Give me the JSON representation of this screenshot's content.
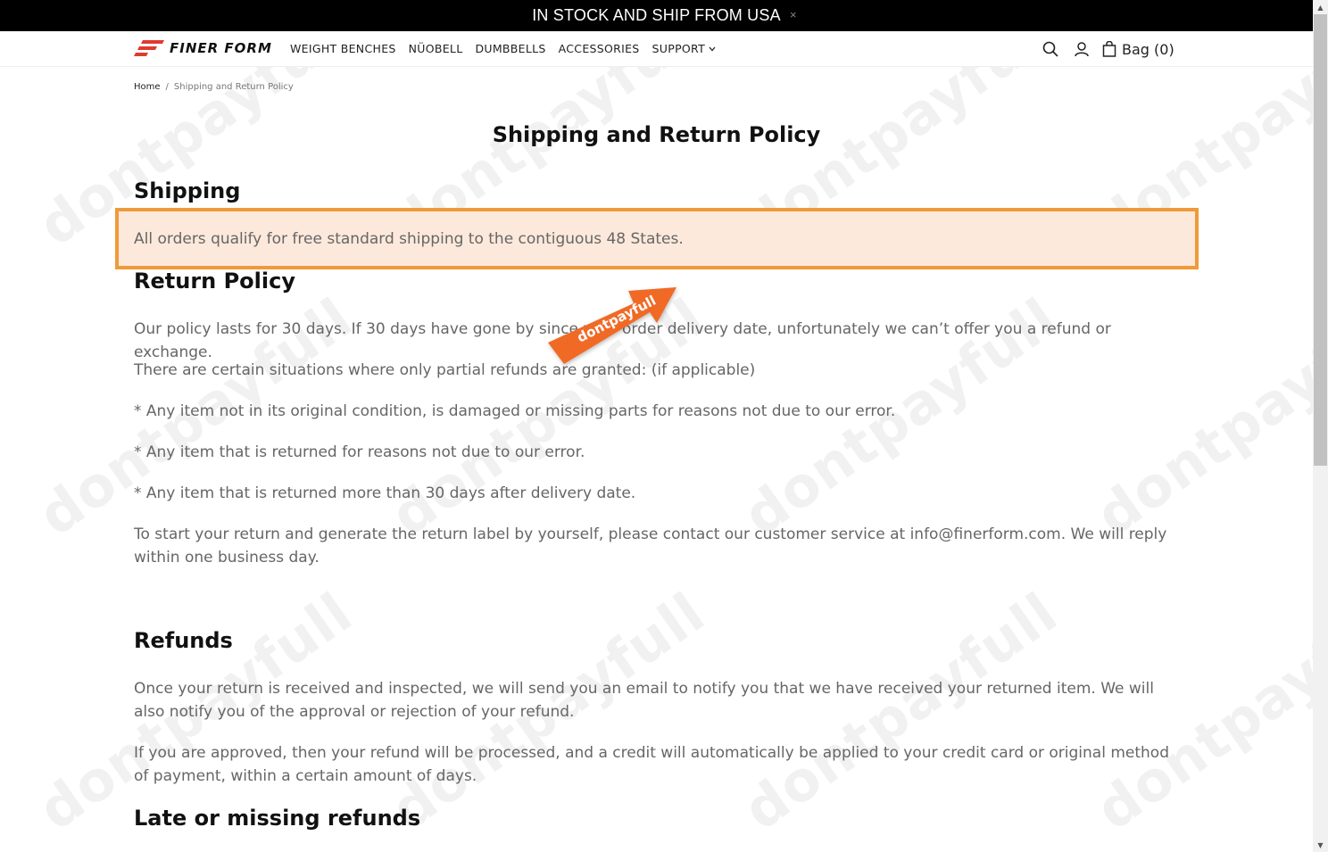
{
  "announcement": {
    "text": "IN STOCK AND SHIP FROM USA",
    "close_symbol": "×"
  },
  "header": {
    "logo_text": "FINER FORM",
    "nav": [
      "WEIGHT BENCHES",
      "NÜOBELL",
      "DUMBBELLS",
      "ACCESSORIES",
      "SUPPORT"
    ],
    "bag_label": "Bag (0)"
  },
  "breadcrumb": {
    "home": "Home",
    "separator": "/",
    "current": "Shipping and Return Policy"
  },
  "page": {
    "title": "Shipping and Return Policy",
    "shipping_heading": "Shipping",
    "shipping_text": "All orders qualify for free standard shipping to the contiguous 48 States.",
    "return_heading": "Return Policy",
    "return_p1": "Our policy lasts for 30 days. If 30 days have gone by since your order delivery date, unfortunately we can’t offer you a refund or exchange.",
    "return_p2": "There are certain situations where only partial refunds are granted: (if applicable)",
    "return_p3": "* Any item not in its original condition, is damaged or missing parts for reasons not due to our error.",
    "return_p4": "* Any item that is returned for reasons not due to our error.",
    "return_p5": "* Any item that is returned more than 30 days after delivery date.",
    "return_p6": "To start your return and generate the return label by yourself, please contact our customer service at info@finerform.com. We will reply within one business day.",
    "refunds_heading": "Refunds",
    "refunds_p1": "Once your return is received and inspected, we will send you an email to notify you that we have received your returned item. We will also notify you of the approval or rejection of your refund.",
    "refunds_p2": "If you are approved, then your refund will be processed, and a credit will automatically be applied to your credit card or original method of payment, within a certain amount of days.",
    "late_heading": "Late or missing refunds"
  },
  "overlay": {
    "watermark": "dontpayfull",
    "arrow_label": "dontpayfull"
  },
  "colors": {
    "highlight_bg": "#fde9db",
    "highlight_border": "#ef9a3a",
    "arrow": "#f06a25",
    "logo_red": "#e03a2f"
  },
  "icons": [
    "close-icon",
    "logo-icon",
    "chevron-down-icon",
    "search-icon",
    "user-icon",
    "bag-icon"
  ]
}
